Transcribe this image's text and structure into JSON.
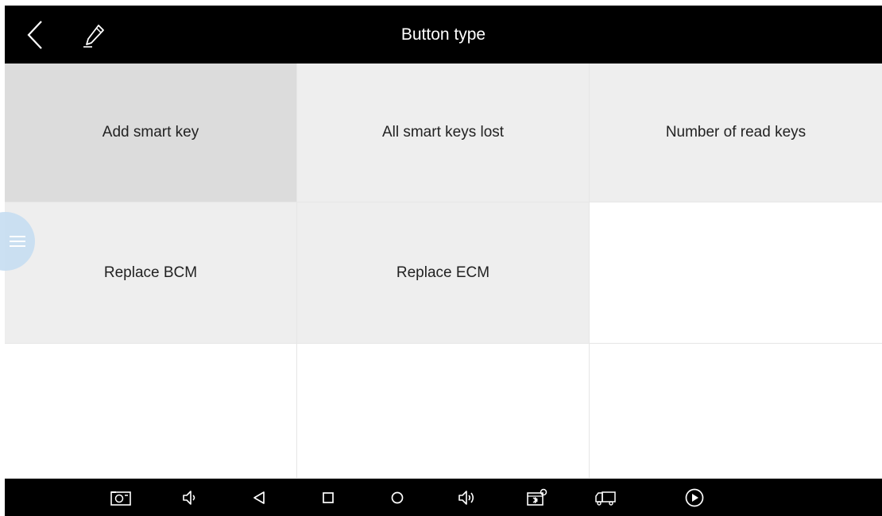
{
  "header": {
    "title": "Button type",
    "back_icon": "chevron-left-icon",
    "edit_icon": "pencil-icon"
  },
  "grid": {
    "cells": [
      {
        "label": "Add smart key",
        "type": "button",
        "selected": true
      },
      {
        "label": "All smart keys lost",
        "type": "button",
        "selected": false
      },
      {
        "label": "Number of read keys",
        "type": "button",
        "selected": false
      },
      {
        "label": "Replace BCM",
        "type": "button",
        "selected": false
      },
      {
        "label": "Replace ECM",
        "type": "button",
        "selected": false
      },
      {
        "label": "",
        "type": "empty"
      },
      {
        "label": "",
        "type": "empty"
      },
      {
        "label": "",
        "type": "empty"
      },
      {
        "label": "",
        "type": "empty"
      }
    ]
  },
  "floating_button": {
    "icon": "menu-icon"
  },
  "navbar": {
    "icons": [
      "screenshot-icon",
      "volume-down-icon",
      "back-triangle-icon",
      "recent-apps-icon",
      "home-circle-icon",
      "volume-up-icon",
      "vci-bluetooth-icon",
      "truck-icon",
      "play-circle-icon"
    ]
  },
  "colors": {
    "bar_background": "#000000",
    "button_background": "#eeeeee",
    "selected_background": "#dcdcdc",
    "floating_button": "#c9dff2"
  }
}
